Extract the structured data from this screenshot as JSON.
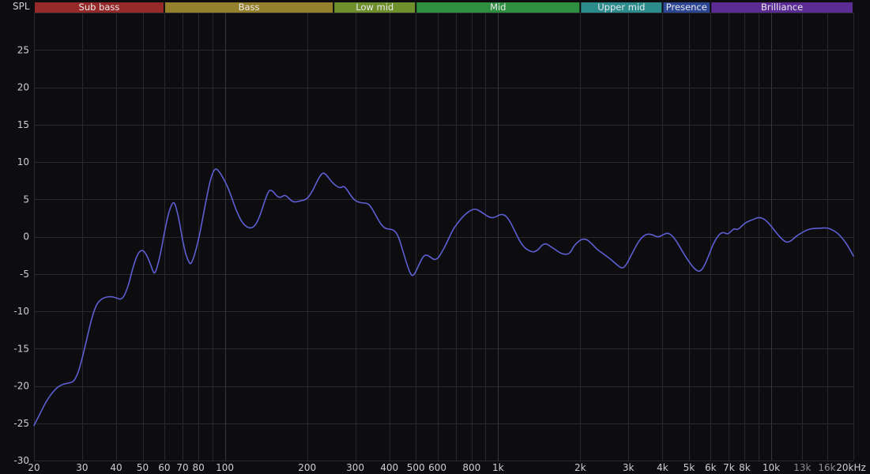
{
  "chart_data": {
    "type": "line",
    "title": "",
    "ylabel": "SPL",
    "xlabel": "",
    "x_scale": "log",
    "xlim": [
      20,
      20000
    ],
    "ylim": [
      -30,
      30
    ],
    "y_grid_step": 5,
    "grid": true,
    "grid_frequencies": [
      20,
      30,
      40,
      50,
      60,
      70,
      80,
      90,
      100,
      200,
      300,
      400,
      500,
      600,
      700,
      800,
      900,
      1000,
      2000,
      3000,
      4000,
      5000,
      6000,
      7000,
      8000,
      9000,
      10000,
      13000,
      16000,
      20000
    ],
    "major_gridlines": [
      100,
      1000,
      10000
    ],
    "x_ticks": [
      {
        "f": 20,
        "label": "20"
      },
      {
        "f": 30,
        "label": "30"
      },
      {
        "f": 40,
        "label": "40"
      },
      {
        "f": 50,
        "label": "50"
      },
      {
        "f": 60,
        "label": "60"
      },
      {
        "f": 70,
        "label": "70"
      },
      {
        "f": 80,
        "label": "80"
      },
      {
        "f": 100,
        "label": "100"
      },
      {
        "f": 200,
        "label": "200"
      },
      {
        "f": 300,
        "label": "300"
      },
      {
        "f": 400,
        "label": "400"
      },
      {
        "f": 500,
        "label": "500"
      },
      {
        "f": 600,
        "label": "600"
      },
      {
        "f": 800,
        "label": "800"
      },
      {
        "f": 1000,
        "label": "1k"
      },
      {
        "f": 2000,
        "label": "2k"
      },
      {
        "f": 3000,
        "label": "3k"
      },
      {
        "f": 4000,
        "label": "4k"
      },
      {
        "f": 5000,
        "label": "5k"
      },
      {
        "f": 6000,
        "label": "6k"
      },
      {
        "f": 7000,
        "label": "7k"
      },
      {
        "f": 8000,
        "label": "8k"
      },
      {
        "f": 10000,
        "label": "10k"
      },
      {
        "f": 13000,
        "label": "13k",
        "dim": true
      },
      {
        "f": 16000,
        "label": "16k",
        "dim": true
      },
      {
        "f": 20000,
        "label": "20kHz"
      }
    ],
    "y_ticks": [
      25,
      20,
      15,
      10,
      5,
      0,
      -5,
      -10,
      -15,
      -20,
      -25,
      -30
    ],
    "bands": [
      {
        "label": "Sub bass",
        "from": 20,
        "to": 60,
        "color": "#962a2a"
      },
      {
        "label": "Bass",
        "from": 60,
        "to": 250,
        "color": "#95802c"
      },
      {
        "label": "Low mid",
        "from": 250,
        "to": 500,
        "color": "#6f8f2c"
      },
      {
        "label": "Mid",
        "from": 500,
        "to": 2000,
        "color": "#2e8f40"
      },
      {
        "label": "Upper mid",
        "from": 2000,
        "to": 4000,
        "color": "#2c8c8c"
      },
      {
        "label": "Presence",
        "from": 4000,
        "to": 6000,
        "color": "#2e4795"
      },
      {
        "label": "Brilliance",
        "from": 6000,
        "to": 20000,
        "color": "#5c2c95"
      }
    ],
    "series": [
      {
        "name": "SPL response",
        "color": "#5d5fd3",
        "points": [
          [
            20,
            -25.3
          ],
          [
            21,
            -23.8
          ],
          [
            22,
            -22.3
          ],
          [
            23,
            -21.2
          ],
          [
            24,
            -20.4
          ],
          [
            25,
            -19.9
          ],
          [
            26,
            -19.7
          ],
          [
            27,
            -19.6
          ],
          [
            28,
            -19.4
          ],
          [
            29,
            -18.3
          ],
          [
            30,
            -16.4
          ],
          [
            31,
            -14.2
          ],
          [
            32,
            -12.0
          ],
          [
            33,
            -10.2
          ],
          [
            34,
            -9.0
          ],
          [
            35,
            -8.5
          ],
          [
            36,
            -8.2
          ],
          [
            38,
            -8.0
          ],
          [
            40,
            -8.2
          ],
          [
            42,
            -8.5
          ],
          [
            44,
            -7.0
          ],
          [
            46,
            -4.2
          ],
          [
            48,
            -2.2
          ],
          [
            50,
            -1.7
          ],
          [
            52,
            -2.6
          ],
          [
            54,
            -4.2
          ],
          [
            55,
            -5.0
          ],
          [
            56,
            -4.6
          ],
          [
            58,
            -2.5
          ],
          [
            60,
            0.5
          ],
          [
            62,
            3.0
          ],
          [
            64,
            4.4
          ],
          [
            65,
            4.6
          ],
          [
            66,
            4.2
          ],
          [
            68,
            2.2
          ],
          [
            70,
            -0.5
          ],
          [
            72,
            -2.5
          ],
          [
            74,
            -3.5
          ],
          [
            75,
            -3.7
          ],
          [
            77,
            -2.8
          ],
          [
            80,
            -0.5
          ],
          [
            83,
            2.5
          ],
          [
            86,
            5.5
          ],
          [
            89,
            8.0
          ],
          [
            92,
            9.2
          ],
          [
            95,
            8.8
          ],
          [
            98,
            8.0
          ],
          [
            102,
            6.8
          ],
          [
            106,
            5.2
          ],
          [
            110,
            3.5
          ],
          [
            115,
            2.0
          ],
          [
            120,
            1.3
          ],
          [
            125,
            1.1
          ],
          [
            130,
            1.6
          ],
          [
            135,
            3.0
          ],
          [
            140,
            4.8
          ],
          [
            145,
            6.3
          ],
          [
            150,
            6.1
          ],
          [
            155,
            5.4
          ],
          [
            160,
            5.2
          ],
          [
            165,
            5.6
          ],
          [
            170,
            5.3
          ],
          [
            175,
            4.8
          ],
          [
            180,
            4.6
          ],
          [
            190,
            4.8
          ],
          [
            200,
            5.0
          ],
          [
            210,
            6.2
          ],
          [
            220,
            7.8
          ],
          [
            228,
            8.6
          ],
          [
            235,
            8.3
          ],
          [
            245,
            7.4
          ],
          [
            255,
            6.8
          ],
          [
            265,
            6.5
          ],
          [
            272,
            6.8
          ],
          [
            280,
            6.3
          ],
          [
            290,
            5.4
          ],
          [
            300,
            4.8
          ],
          [
            310,
            4.6
          ],
          [
            320,
            4.5
          ],
          [
            330,
            4.5
          ],
          [
            340,
            4.2
          ],
          [
            355,
            3.0
          ],
          [
            370,
            1.8
          ],
          [
            385,
            1.1
          ],
          [
            400,
            1.0
          ],
          [
            415,
            0.9
          ],
          [
            430,
            0.2
          ],
          [
            445,
            -1.5
          ],
          [
            460,
            -3.3
          ],
          [
            475,
            -4.8
          ],
          [
            485,
            -5.3
          ],
          [
            495,
            -5.0
          ],
          [
            510,
            -4.0
          ],
          [
            525,
            -3.0
          ],
          [
            540,
            -2.4
          ],
          [
            560,
            -2.6
          ],
          [
            580,
            -3.1
          ],
          [
            600,
            -3.0
          ],
          [
            620,
            -2.2
          ],
          [
            650,
            -0.8
          ],
          [
            680,
            0.8
          ],
          [
            710,
            1.8
          ],
          [
            740,
            2.6
          ],
          [
            770,
            3.2
          ],
          [
            800,
            3.6
          ],
          [
            830,
            3.7
          ],
          [
            860,
            3.4
          ],
          [
            900,
            2.9
          ],
          [
            940,
            2.5
          ],
          [
            980,
            2.6
          ],
          [
            1020,
            3.0
          ],
          [
            1060,
            2.9
          ],
          [
            1100,
            2.2
          ],
          [
            1150,
            0.8
          ],
          [
            1200,
            -0.6
          ],
          [
            1250,
            -1.5
          ],
          [
            1300,
            -1.9
          ],
          [
            1350,
            -2.1
          ],
          [
            1400,
            -1.8
          ],
          [
            1450,
            -1.1
          ],
          [
            1500,
            -0.9
          ],
          [
            1550,
            -1.3
          ],
          [
            1600,
            -1.6
          ],
          [
            1700,
            -2.3
          ],
          [
            1800,
            -2.4
          ],
          [
            1850,
            -2.0
          ],
          [
            1900,
            -1.2
          ],
          [
            2000,
            -0.4
          ],
          [
            2100,
            -0.3
          ],
          [
            2200,
            -0.9
          ],
          [
            2300,
            -1.7
          ],
          [
            2450,
            -2.4
          ],
          [
            2600,
            -3.1
          ],
          [
            2750,
            -3.9
          ],
          [
            2850,
            -4.3
          ],
          [
            2950,
            -3.8
          ],
          [
            3100,
            -2.2
          ],
          [
            3250,
            -0.8
          ],
          [
            3400,
            0.1
          ],
          [
            3550,
            0.4
          ],
          [
            3700,
            0.2
          ],
          [
            3850,
            -0.1
          ],
          [
            4000,
            0.2
          ],
          [
            4150,
            0.5
          ],
          [
            4300,
            0.3
          ],
          [
            4500,
            -0.6
          ],
          [
            4700,
            -1.8
          ],
          [
            4900,
            -2.9
          ],
          [
            5100,
            -3.8
          ],
          [
            5300,
            -4.5
          ],
          [
            5500,
            -4.7
          ],
          [
            5700,
            -3.9
          ],
          [
            5900,
            -2.6
          ],
          [
            6100,
            -1.2
          ],
          [
            6300,
            -0.2
          ],
          [
            6500,
            0.4
          ],
          [
            6700,
            0.6
          ],
          [
            6900,
            0.3
          ],
          [
            7100,
            0.6
          ],
          [
            7300,
            1.1
          ],
          [
            7500,
            0.9
          ],
          [
            7700,
            1.2
          ],
          [
            8000,
            1.8
          ],
          [
            8300,
            2.1
          ],
          [
            8600,
            2.3
          ],
          [
            9000,
            2.6
          ],
          [
            9400,
            2.4
          ],
          [
            9800,
            1.8
          ],
          [
            10200,
            1.0
          ],
          [
            10600,
            0.2
          ],
          [
            11000,
            -0.4
          ],
          [
            11400,
            -0.8
          ],
          [
            11800,
            -0.6
          ],
          [
            12300,
            0
          ],
          [
            12900,
            0.5
          ],
          [
            13500,
            0.9
          ],
          [
            14200,
            1.1
          ],
          [
            15000,
            1.1
          ],
          [
            16000,
            1.2
          ],
          [
            16800,
            0.9
          ],
          [
            17600,
            0.4
          ],
          [
            18400,
            -0.4
          ],
          [
            19200,
            -1.4
          ],
          [
            20000,
            -2.6
          ]
        ]
      }
    ],
    "colors": {
      "background": "#0d0d0f",
      "grid": "#29292c",
      "grid_major": "#36363a",
      "tick_label": "#ccd0d4",
      "tick_label_dim": "#8a8e94",
      "band_label": "#e9e9ec"
    }
  }
}
